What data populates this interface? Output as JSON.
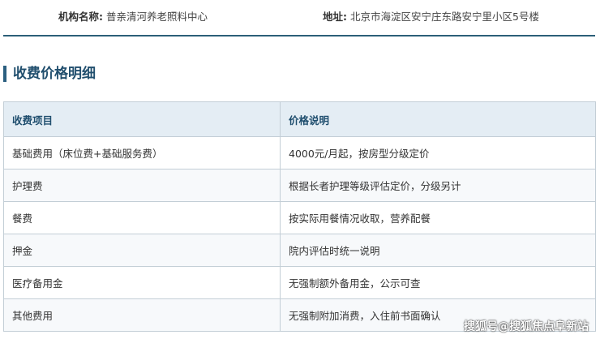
{
  "info": {
    "org_label": "机构名称:",
    "org_value": "普亲清河养老照料中心",
    "addr_label": "地址:",
    "addr_value": "北京市海淀区安宁庄东路安宁里小区5号楼"
  },
  "section": {
    "title": "收费价格明细"
  },
  "table": {
    "headers": [
      "收费项目",
      "价格说明"
    ],
    "rows": [
      [
        "基础费用（床位费+基础服务费）",
        "4000元/月起，按房型分级定价"
      ],
      [
        "护理费",
        "根据长者护理等级评估定价，分级另计"
      ],
      [
        "餐费",
        "按实际用餐情况收取，营养配餐"
      ],
      [
        "押金",
        "院内评估时统一说明"
      ],
      [
        "医疗备用金",
        "无强制额外备用金，公示可查"
      ],
      [
        "其他费用",
        "无强制附加消费，入住前书面确认"
      ]
    ]
  },
  "watermark": "搜狐号@搜狐焦点阜新站",
  "colors": {
    "accent": "#2b5f80",
    "header_bg": "#e4edf4",
    "border": "#c3ced6"
  }
}
